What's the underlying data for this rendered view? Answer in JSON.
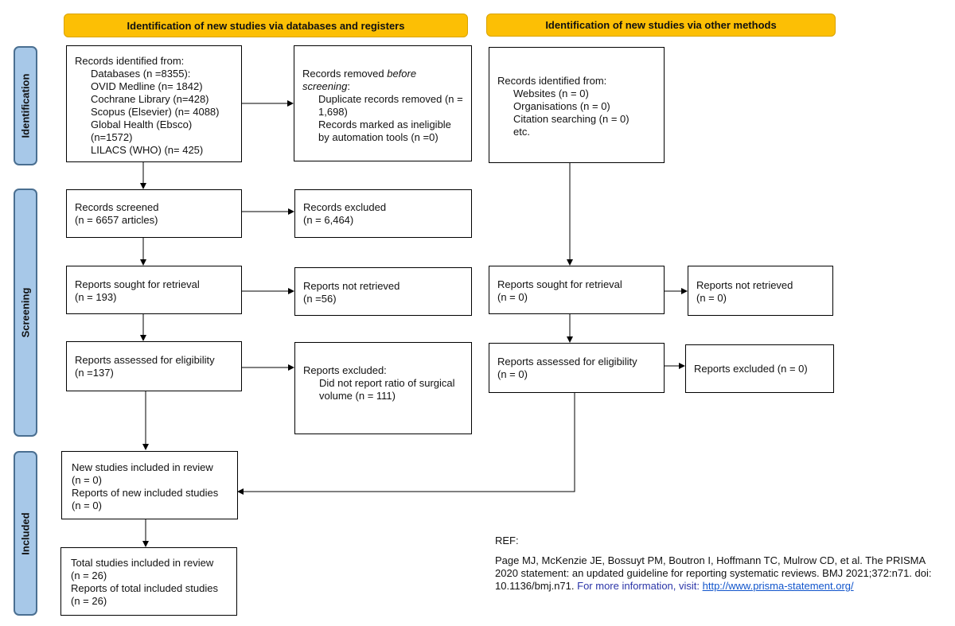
{
  "headers": {
    "databases": "Identification of new studies via databases and registers",
    "other": "Identification of new studies via other methods"
  },
  "phases": [
    "Identification",
    "Screening",
    "Included"
  ],
  "databases": {
    "identified": {
      "title": "Records identified from:",
      "lines": [
        "Databases (n =8355):",
        "OVID Medline (n= 1842)",
        "Cochrane Library (n=428)",
        "Scopus (Elsevier) (n= 4088)",
        "Global Health (Ebsco) (n=1572)",
        "LILACS (WHO) (n= 425)"
      ]
    },
    "removed": {
      "title_pre": "Records removed ",
      "title_em": "before screening",
      "title_post": ":",
      "lines": [
        "Duplicate records removed (n = 1,698)",
        "Records marked as ineligible by automation tools (n =0)"
      ]
    },
    "screened": {
      "title": "Records screened",
      "count": "(n = 6657 articles)"
    },
    "excluded": {
      "title": "Records excluded",
      "count": "(n = 6,464)"
    },
    "sought": {
      "title": "Reports sought for retrieval",
      "count": "(n = 193)"
    },
    "not_retrieved": {
      "title": "Reports not retrieved",
      "count": "(n =56)"
    },
    "assessed": {
      "title": "Reports assessed for eligibility",
      "count": "(n =137)"
    },
    "reports_excluded": {
      "title": "Reports excluded:",
      "reason": "Did not report ratio of surgical volume (n = 111)"
    }
  },
  "other": {
    "identified": {
      "title": "Records identified from:",
      "lines": [
        "Websites (n = 0)",
        "Organisations (n = 0)",
        "Citation searching (n = 0)",
        "etc."
      ]
    },
    "sought": {
      "title": "Reports sought for retrieval",
      "count": "(n = 0)"
    },
    "not_retrieved": {
      "title": "Reports not retrieved",
      "count": "(n = 0)"
    },
    "assessed": {
      "title": "Reports assessed for eligibility",
      "count": "(n = 0)"
    },
    "excluded": {
      "title": "Reports excluded (n = 0)"
    }
  },
  "included": {
    "new": [
      "New studies included in review",
      "(n = 0)",
      "Reports of new included studies",
      "(n = 0)"
    ],
    "total": [
      "Total studies included in review",
      "(n = 26)",
      "Reports of total included studies",
      "(n = 26)"
    ]
  },
  "reference": {
    "label": "REF:",
    "citation": "Page MJ, McKenzie JE, Bossuyt PM, Boutron I, Hoffmann TC, Mulrow CD, et al. The PRISMA 2020 statement: an updated guideline for reporting systematic reviews. BMJ 2021;372:n71. doi: 10.1136/bmj.n71.",
    "more_info": "For more information, visit:",
    "url": "http://www.prisma-statement.org/"
  },
  "colors": {
    "header": "#fcbf05",
    "phase": "#a7c8e8",
    "link": "#1155cc"
  }
}
